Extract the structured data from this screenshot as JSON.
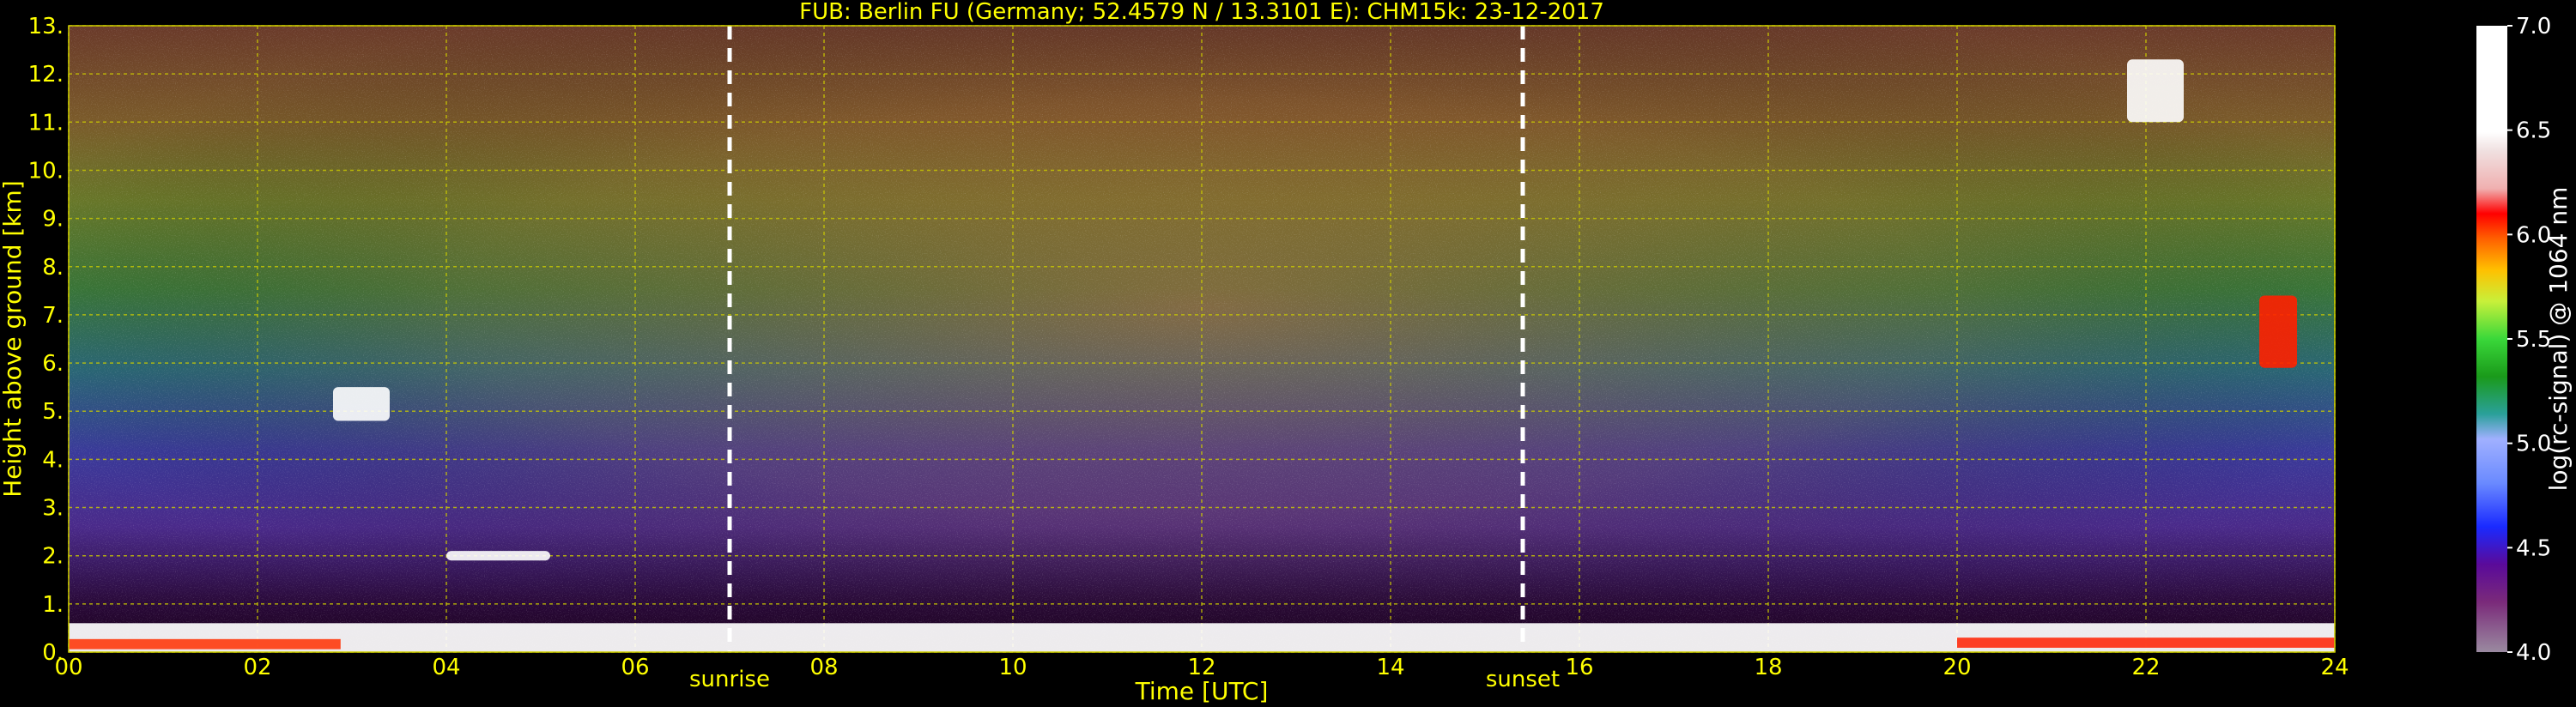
{
  "chart_data": {
    "type": "heatmap",
    "title": "FUB: Berlin FU (Germany; 52.4579 N / 13.3101 E):    CHM15k: 23-12-2017",
    "xlabel": "Time [UTC]",
    "ylabel": "Height above ground [km]",
    "xlim": [
      0,
      24
    ],
    "ylim": [
      0,
      13
    ],
    "x_ticks": [
      "00",
      "02",
      "04",
      "06",
      "08",
      "10",
      "12",
      "14",
      "16",
      "18",
      "20",
      "22",
      "24"
    ],
    "y_ticks": [
      "0.",
      "1.",
      "2.",
      "3.",
      "4.",
      "5.",
      "6.",
      "7.",
      "8.",
      "9.",
      "10.",
      "11.",
      "12.",
      "13."
    ],
    "grid": true,
    "colorbar": {
      "label": "log(rc-signal) @ 1064 nm",
      "range": [
        4.0,
        7.0
      ],
      "ticks": [
        "4.0",
        "4.5",
        "5.0",
        "5.5",
        "6.0",
        "6.5",
        "7.0"
      ]
    },
    "markers": [
      {
        "label": "sunrise",
        "time": 7.0
      },
      {
        "label": "sunset",
        "time": 15.4
      }
    ],
    "features": [
      {
        "name": "boundary layer",
        "time_range": [
          0,
          24
        ],
        "height_range": [
          0,
          0.6
        ],
        "log_signal": 6.5
      },
      {
        "name": "cloud",
        "time_range": [
          2.8,
          3.4
        ],
        "height_range": [
          4.8,
          5.5
        ],
        "log_signal": 7.0
      },
      {
        "name": "cloud",
        "time_range": [
          4.0,
          5.1
        ],
        "height_range": [
          1.9,
          2.1
        ],
        "log_signal": 7.0
      },
      {
        "name": "cirrus",
        "time_range": [
          21.8,
          22.4
        ],
        "height_range": [
          11.0,
          12.3
        ],
        "log_signal": 6.5
      },
      {
        "name": "cloud",
        "time_range": [
          23.2,
          23.6
        ],
        "height_range": [
          5.9,
          7.4
        ],
        "log_signal": 6.0
      }
    ]
  }
}
